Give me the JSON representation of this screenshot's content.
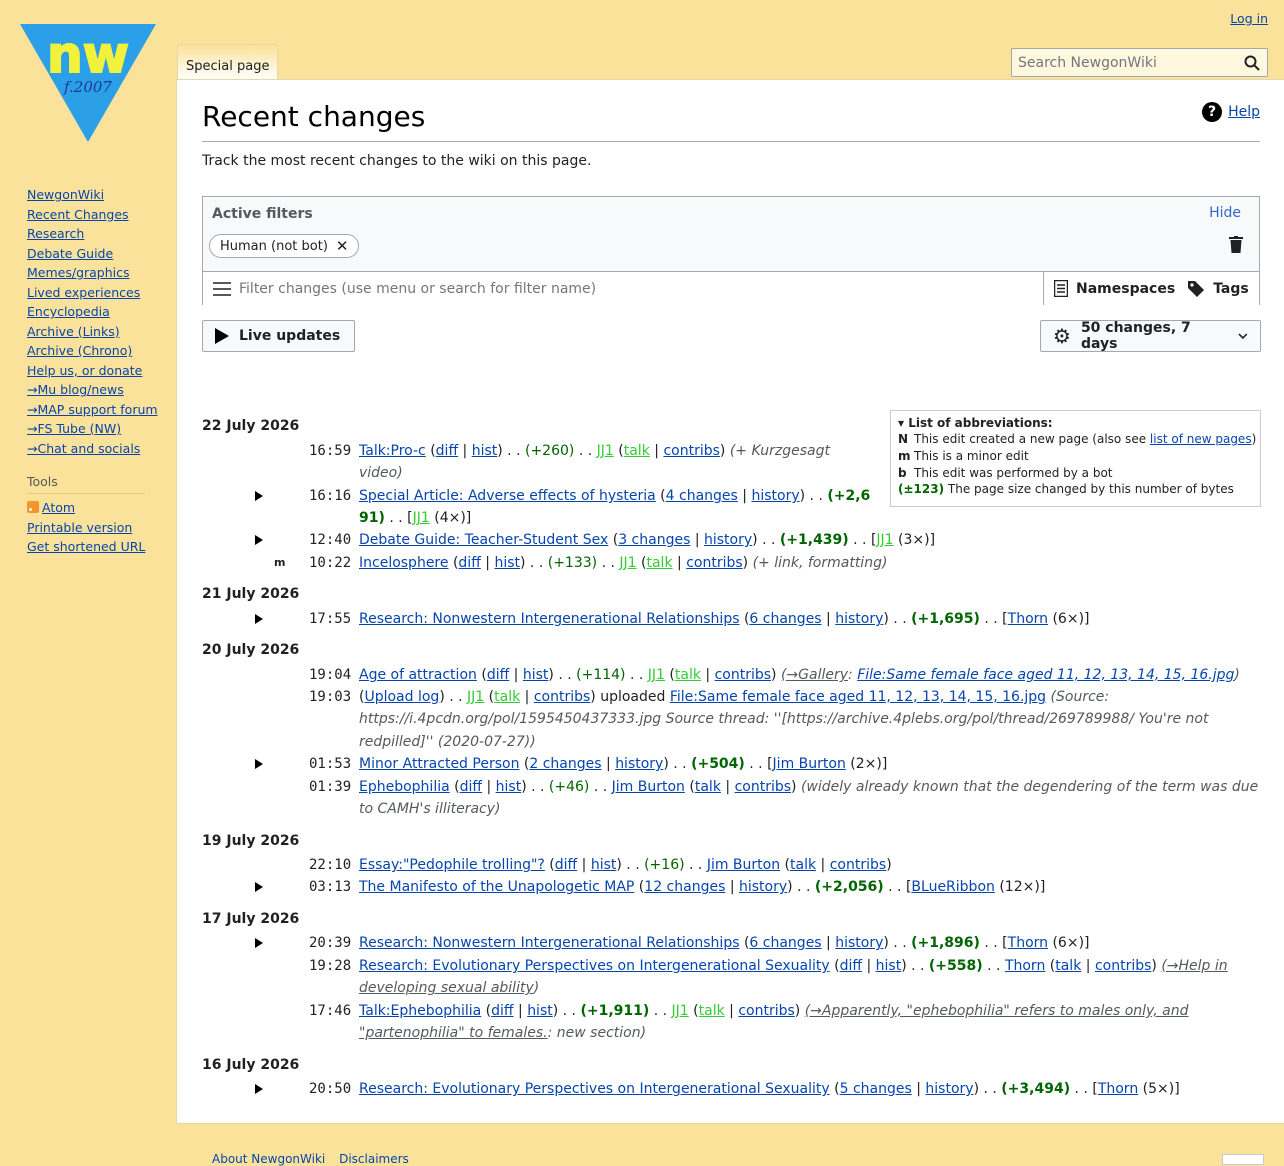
{
  "logo": {
    "letters": "nw",
    "founded": "f.2007"
  },
  "header": {
    "login": "Log in",
    "tab_special": "Special page",
    "search_placeholder": "Search NewgonWiki"
  },
  "sidebar": {
    "nav": [
      "NewgonWiki",
      "Recent Changes",
      "Research",
      "Debate Guide",
      "Memes/graphics",
      "Lived experiences",
      "Encyclopedia",
      "Archive (Links)",
      "Archive (Chrono)",
      "Help us, or donate",
      "→Mu blog/news",
      "→MAP support forum",
      "→FS Tube (NW)",
      "→Chat and socials"
    ],
    "tools_heading": "Tools",
    "tools": [
      "Atom",
      "Printable version",
      "Get shortened URL"
    ]
  },
  "main": {
    "title": "Recent changes",
    "help": "Help",
    "intro": "Track the most recent changes to the wiki on this page.",
    "filters": {
      "title": "Active filters",
      "hide": "Hide",
      "chip": "Human (not bot)",
      "placeholder": "Filter changes (use menu or search for filter name)",
      "namespaces": "Namespaces",
      "tags": "Tags"
    },
    "live_updates": "Live updates",
    "changes_setting": "50 changes, 7 days"
  },
  "legend": {
    "title": "List of abbreviations:",
    "n_key": "N",
    "n_text": "This edit created a new page (also see ",
    "n_link": "list of new pages",
    "n_end": ")",
    "m_key": "m",
    "m_text": "This is a minor edit",
    "b_key": "b",
    "b_text": "This edit was performed by a bot",
    "size_key": "(±123)",
    "size_text": "The page size changed by this number of bytes"
  },
  "days": [
    "22 July 2026",
    "21 July 2026",
    "20 July 2026",
    "19 July 2026",
    "17 July 2026",
    "16 July 2026"
  ],
  "entries": [
    {
      "time": "16:59",
      "page": "Talk:Pro-c",
      "diff": "diff",
      "hist": "hist",
      "size": "(+260)",
      "user": "JJ1",
      "talk": "talk",
      "contribs": "contribs",
      "summary": "(+ Kurzgesagt",
      "summary2": "video)"
    },
    {
      "time": "16:16",
      "page": "Special Article: Adverse effects of hysteria",
      "changes": "4 changes",
      "history": "history",
      "size": "(+2,6",
      "size2": "91)",
      "user": "JJ1",
      "count": "(4×)"
    },
    {
      "time": "12:40",
      "page": "Debate Guide: Teacher-Student Sex",
      "changes": "3 changes",
      "history": "history",
      "size": "(+1,439)",
      "user": "JJ1",
      "count": "(3×)"
    },
    {
      "flag": "m",
      "time": "10:22",
      "page": "Incelosphere",
      "diff": "diff",
      "hist": "hist",
      "size": "(+133)",
      "user": "JJ1",
      "talk": "talk",
      "contribs": "contribs",
      "summary": "(+ link, formatting)"
    },
    {
      "time": "17:55",
      "page": "Research: Nonwestern Intergenerational Relationships",
      "changes": "6 changes",
      "history": "history",
      "size": "(+1,695)",
      "user": "Thorn",
      "count": "(6×)"
    },
    {
      "time": "19:04",
      "page": "Age of attraction",
      "diff": "diff",
      "hist": "hist",
      "size": "(+114)",
      "user": "JJ1",
      "talk": "talk",
      "contribs": "contribs",
      "summary_arrow": "(→Gallery",
      "summary_colon": ":",
      "summary_link": "File:Same female face aged 11, 12, 13, 14, 15, 16.jpg",
      "summary_end": ")"
    },
    {
      "time": "19:03",
      "log": "Upload log",
      "user": "JJ1",
      "talk": "talk",
      "contribs": "contribs",
      "action": "uploaded",
      "file": "File:Same female face aged 11, 12, 13, 14, 15, 16.jpg",
      "summary": "(Source:",
      "summary2": "https://i.4pcdn.org/pol/1595450437333.jpg Source thread: ''[https://archive.4plebs.org/pol/thread/269789988/ You're not",
      "summary3": "redpilled]'' (2020-07-27))"
    },
    {
      "time": "01:53",
      "page": "Minor Attracted Person",
      "changes": "2 changes",
      "history": "history",
      "size": "(+504)",
      "user": "Jim Burton",
      "count": "(2×)"
    },
    {
      "time": "01:39",
      "page": "Ephebophilia",
      "diff": "diff",
      "hist": "hist",
      "size": "(+46)",
      "user": "Jim Burton",
      "talk": "talk",
      "contribs": "contribs",
      "summary": "(widely already known that the degendering of the term was due",
      "summary2": "to CAMH's illiteracy)"
    },
    {
      "time": "22:10",
      "page": "Essay:\"Pedophile trolling\"?",
      "diff": "diff",
      "hist": "hist",
      "size": "(+16)",
      "user": "Jim Burton",
      "talk": "talk",
      "contribs": "contribs"
    },
    {
      "time": "03:13",
      "page": "The Manifesto of the Unapologetic MAP",
      "changes": "12 changes",
      "history": "history",
      "size": "(+2,056)",
      "user": "BLueRibbon",
      "count": "(12×)"
    },
    {
      "time": "20:39",
      "page": "Research: Nonwestern Intergenerational Relationships",
      "changes": "6 changes",
      "history": "history",
      "size": "(+1,896)",
      "user": "Thorn",
      "count": "(6×)"
    },
    {
      "time": "19:28",
      "page": "Research: Evolutionary Perspectives on Intergenerational Sexuality",
      "diff": "diff",
      "hist": "hist",
      "size": "(+558)",
      "user": "Thorn",
      "talk": "talk",
      "contribs": "contribs",
      "summary_arrow": "(→Help in",
      "summary_arrow2": "developing sexual ability",
      "summary_end": ")"
    },
    {
      "time": "17:46",
      "page": "Talk:Ephebophilia",
      "diff": "diff",
      "hist": "hist",
      "size": "(+1,911)",
      "user": "JJ1",
      "talk": "talk",
      "contribs": "contribs",
      "summary_arrow": "(→Apparently, \"ephebophilia\" refers to males only, and",
      "summary_arrow2": "\"partenophilia\" to females.",
      "summary_colon": ":",
      "summary_end": " new section)"
    },
    {
      "time": "20:50",
      "page": "Research: Evolutionary Perspectives on Intergenerational Sexuality",
      "changes": "5 changes",
      "history": "history",
      "size": "(+3,494)",
      "user": "Thorn",
      "count": "(5×)"
    }
  ],
  "footer": {
    "about": "About NewgonWiki",
    "disclaimers": "Disclaimers"
  },
  "colors": {
    "background": "#fbe29a",
    "link": "#0645ad",
    "positive": "#006400",
    "user_green": "#33cc33",
    "logo_blue": "#2b9fe8",
    "logo_yellow": "#f2f23c"
  }
}
